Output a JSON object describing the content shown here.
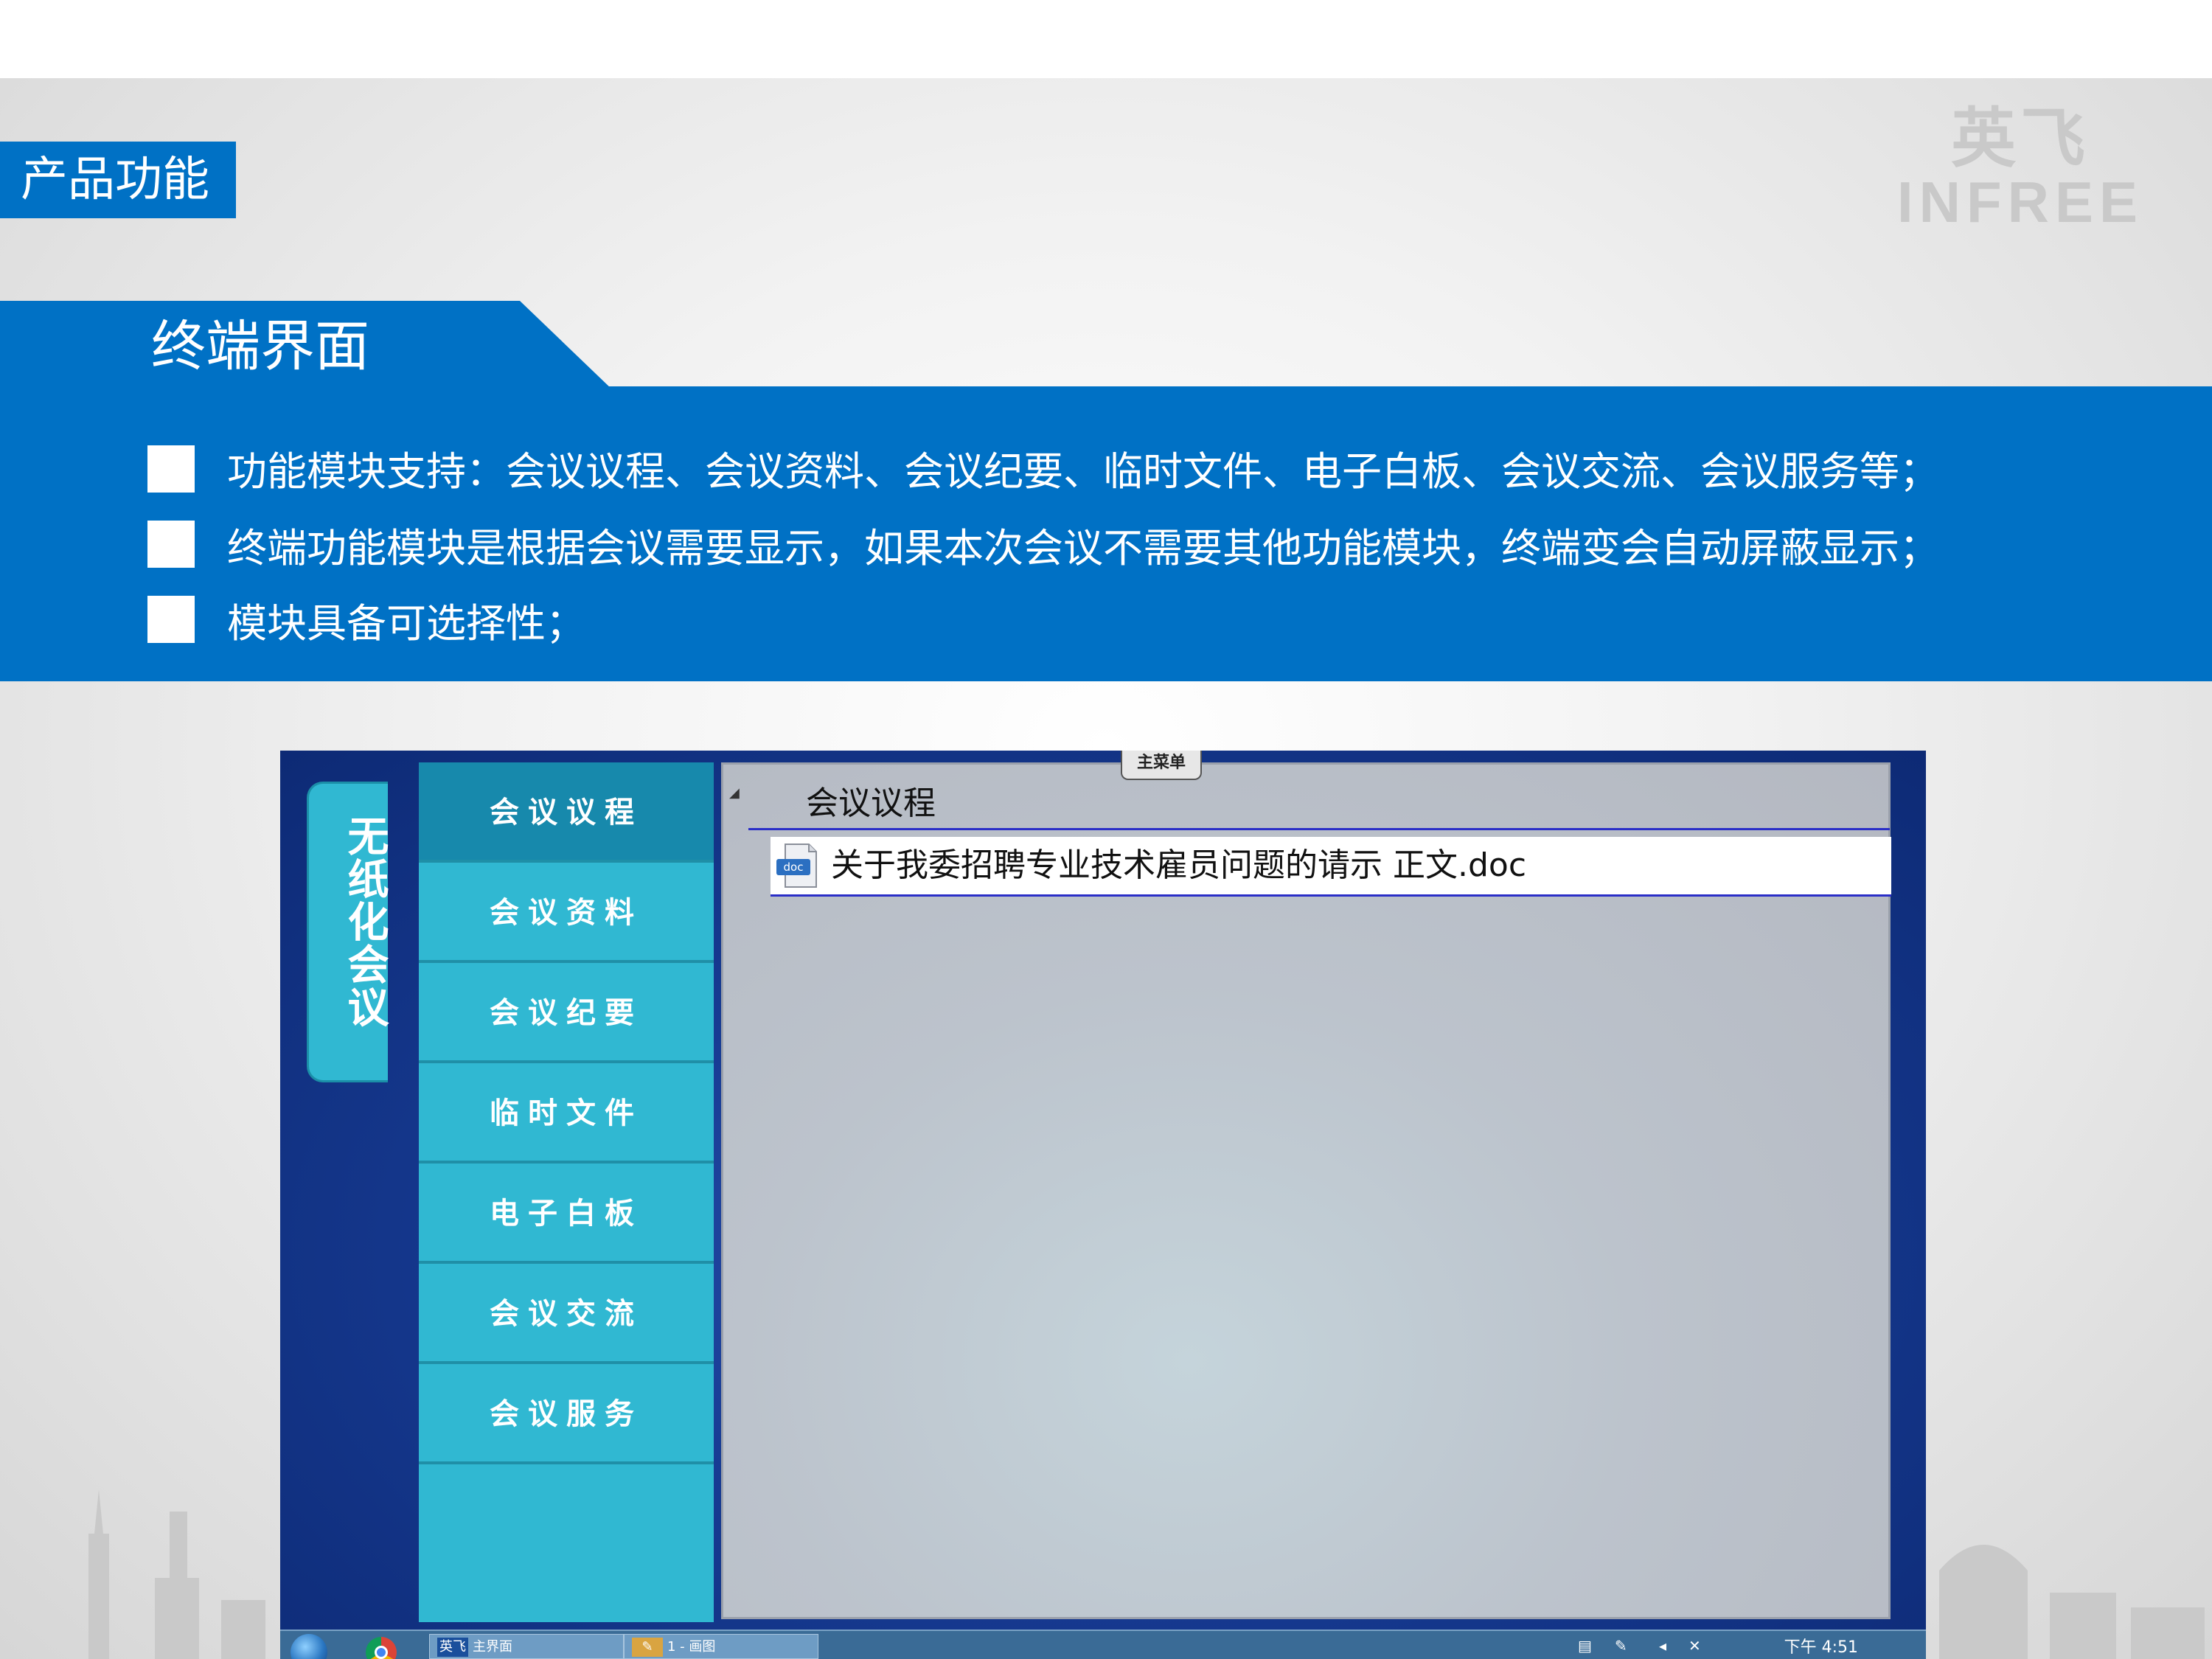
{
  "section_tag": "产品功能",
  "logo": {
    "cn": "英飞",
    "en": "INFREE"
  },
  "tab_title": "终端界面",
  "bullets": [
    "功能模块支持：会议议程、会议资料、会议纪要、临时文件、电子白板、会议交流、会议服务等；",
    "终端功能模块是根据会议需要显示，如果本次会议不需要其他功能模块，终端变会自动屏蔽显示；",
    "模块具备可选择性；"
  ],
  "app": {
    "vertical_tab": "无纸化会议",
    "top_tab": "主菜单",
    "menu": [
      "会议议程",
      "会议资料",
      "会议纪要",
      "临时文件",
      "电子白板",
      "会议交流",
      "会议服务"
    ],
    "active_menu": "会议议程",
    "panel_title": "会议议程",
    "files": [
      {
        "icon": "doc",
        "name": "关于我委招聘专业技术雇员问题的请示 正文.doc"
      }
    ]
  },
  "taskbar": {
    "items": [
      {
        "icon": "英飞",
        "label": "主界面"
      },
      {
        "icon": "paint-icon",
        "label": "1 - 画图"
      }
    ],
    "time": "下午 4:51"
  },
  "colors": {
    "brand_blue": "#0071c5",
    "menu_cyan": "#30b8d2",
    "menu_active": "#1789ac"
  }
}
